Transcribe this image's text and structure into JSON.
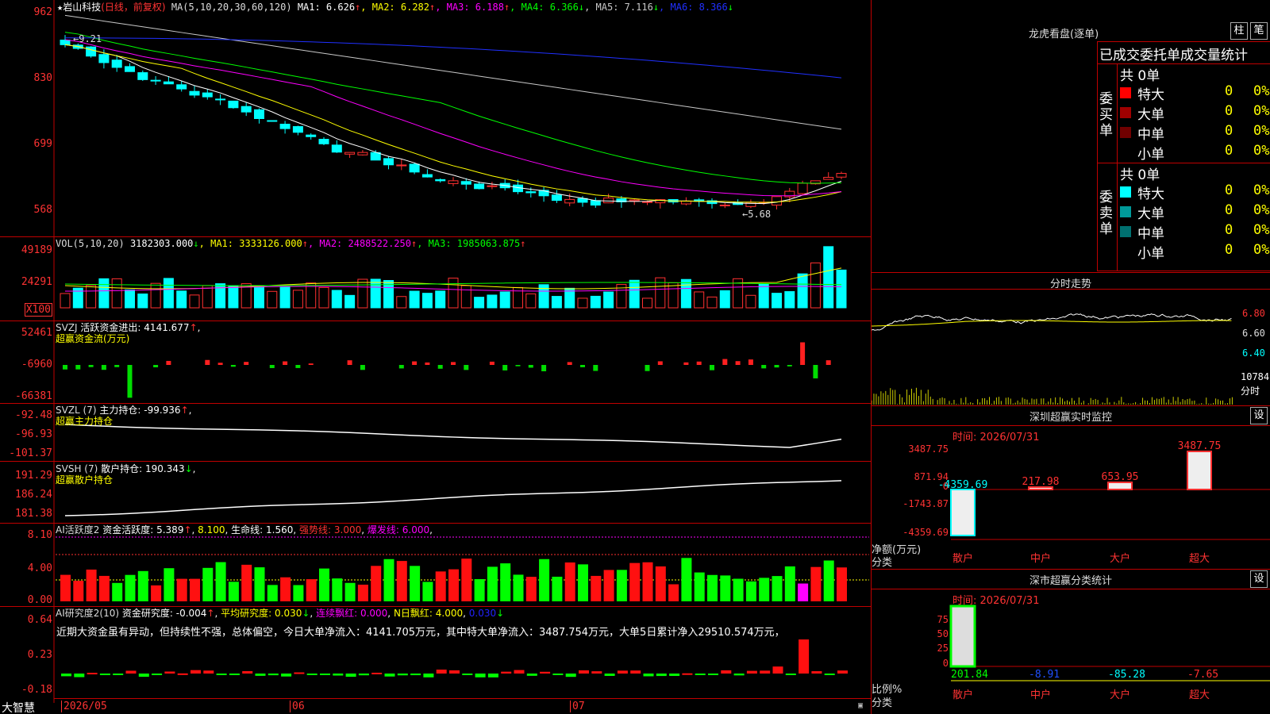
{
  "stock": {
    "star": "★",
    "name": "岩山科技",
    "period": "(日线，前复权)"
  },
  "price_panel": {
    "ma_params": "MA(5,10,20,30,60,120)",
    "ma_values": [
      {
        "label": "MA1:",
        "value": "6.626",
        "arrow": "↑",
        "color": "#ffffff"
      },
      {
        "label": "MA2:",
        "value": "6.282",
        "arrow": "↑",
        "color": "#ffff00"
      },
      {
        "label": "MA3:",
        "value": "6.188",
        "arrow": "↑",
        "color": "#ff00ff"
      },
      {
        "label": "MA4:",
        "value": "6.366",
        "arrow": "↓",
        "color": "#00ff00"
      },
      {
        "label": "MA5:",
        "value": "7.116",
        "arrow": "↓",
        "color": "#c8c8c8"
      },
      {
        "label": "MA6:",
        "value": "8.366",
        "arrow": "↓",
        "color": "#2030ff"
      }
    ],
    "y_ticks": [
      "962",
      "830",
      "699",
      "568"
    ],
    "high_marker": "9.21",
    "low_marker": "5.68"
  },
  "vol_panel": {
    "label": "VOL(5,10,20)",
    "value": "3182303.000",
    "arrow": "↓",
    "ma": [
      {
        "label": "MA1:",
        "value": "3333126.000",
        "arrow": "↑",
        "color": "#ffff00"
      },
      {
        "label": "MA2:",
        "value": "2488522.250",
        "arrow": "↑",
        "color": "#ff00ff"
      },
      {
        "label": "MA3:",
        "value": "1985063.875",
        "arrow": "↑",
        "color": "#00ff00"
      }
    ],
    "y_ticks": [
      "49189",
      "24291"
    ],
    "unit": "X100"
  },
  "svzj_panel": {
    "label": "SVZJ",
    "title": "活跃资金进出:",
    "value": "4141.677",
    "arrow": "↑",
    "subtitle": "超赢资金流(万元)",
    "y_ticks": [
      "52461",
      "-6960",
      "-66381"
    ]
  },
  "svzl_panel": {
    "label": "SVZL (7)",
    "title": "主力持仓:",
    "value": "-99.936",
    "arrow": "↑",
    "subtitle": "超赢主力持仓",
    "y_ticks": [
      "-92.48",
      "-96.93",
      "-101.37"
    ]
  },
  "svsh_panel": {
    "label": "SVSH (7)",
    "title": "散户持仓:",
    "value": "190.343",
    "arrow": "↓",
    "subtitle": "超赢散户持仓",
    "y_ticks": [
      "191.29",
      "186.24",
      "181.38"
    ]
  },
  "ai2_panel": {
    "title": "AI活跃度2",
    "f1": "资金活跃度:",
    "v1": "5.389",
    "a1": "↑",
    "v2": "8.100",
    "f3": "生命线:",
    "v3": "1.560",
    "f4": "强势线:",
    "v4": "3.000",
    "f5": "爆发线:",
    "v5": "6.000",
    "y_ticks": [
      "8.10",
      "4.00",
      "0.00"
    ]
  },
  "ai_research_panel": {
    "title": "AI研究度2(10)",
    "f1": "资金研究度:",
    "v1": "-0.004",
    "a1": "↑",
    "f2": "平均研究度:",
    "v2": "0.030",
    "a2": "↓",
    "f3": "连续飘红:",
    "v3": "0.000",
    "f4": "N日飘红:",
    "v4": "4.000",
    "v5": "0.030",
    "a5": "↓",
    "comment": "近期大资金虽有异动，但持续性不强，总体偏空，今日大单净流入：4141.705万元，其中特大单净流入：3487.754万元，大单5日累计净入29510.574万元，",
    "y_ticks": [
      "0.64",
      "0.23",
      "-0.18"
    ]
  },
  "bottom_axis": {
    "brand": "大智慧",
    "dates": [
      "2026/05",
      "06",
      "07"
    ]
  },
  "dragon_tiger": {
    "title": "龙虎看盘(逐单)",
    "btn1": "柱",
    "btn2": "笔",
    "header": "已成交委托单成交量统计",
    "buy": {
      "side": "委买单",
      "total": "共 0单",
      "rows": [
        {
          "label": "特大",
          "count": "0",
          "pct": "0%",
          "color": "#ff0000"
        },
        {
          "label": "大单",
          "count": "0",
          "pct": "0%",
          "color": "#a00000"
        },
        {
          "label": "中单",
          "count": "0",
          "pct": "0%",
          "color": "#700000"
        },
        {
          "label": "小单",
          "count": "0",
          "pct": "0%",
          "color": "#000000"
        }
      ]
    },
    "sell": {
      "side": "委卖单",
      "total": "共 0单",
      "rows": [
        {
          "label": "特大",
          "count": "0",
          "pct": "0%",
          "color": "#00ffff"
        },
        {
          "label": "大单",
          "count": "0",
          "pct": "0%",
          "color": "#009a9a"
        },
        {
          "label": "中单",
          "count": "0",
          "pct": "0%",
          "color": "#007070"
        },
        {
          "label": "小单",
          "count": "0",
          "pct": "0%",
          "color": "#000000"
        }
      ]
    }
  },
  "intraday": {
    "title": "分时走势",
    "y_labels": [
      "6.80",
      "6.60",
      "6.40"
    ],
    "vol_label": "10784",
    "vol_unit": "分时"
  },
  "monitor": {
    "title": "深圳超赢实时监控",
    "btn": "设",
    "time_label": "时间:",
    "time": "2026/07/31",
    "y_labels": [
      "3487.75",
      "871.94",
      "0",
      "-1743.87",
      "-4359.69"
    ],
    "bars": [
      {
        "cat": "散户",
        "value": "-4359.69",
        "color": "#00ffff"
      },
      {
        "cat": "中户",
        "value": "217.98",
        "color": "#ff3030"
      },
      {
        "cat": "大户",
        "value": "653.95",
        "color": "#ff3030"
      },
      {
        "cat": "超大",
        "value": "3487.75",
        "color": "#ff3030"
      }
    ],
    "ylabel": "净额(万元)",
    "xlabel": "分类"
  },
  "classify": {
    "title": "深市超赢分类统计",
    "btn": "设",
    "time_label": "时间:",
    "time": "2026/07/31",
    "y_labels": [
      "75",
      "50",
      "25",
      "0"
    ],
    "bars": [
      {
        "cat": "散户",
        "value": "201.84",
        "color": "#00ff00"
      },
      {
        "cat": "中户",
        "value": "-8.91",
        "color": "#2050ff"
      },
      {
        "cat": "大户",
        "value": "-85.28",
        "color": "#00ffff"
      },
      {
        "cat": "超大",
        "value": "-7.65",
        "color": "#ff3030"
      }
    ],
    "ylabel": "比例%",
    "xlabel": "分类"
  }
}
